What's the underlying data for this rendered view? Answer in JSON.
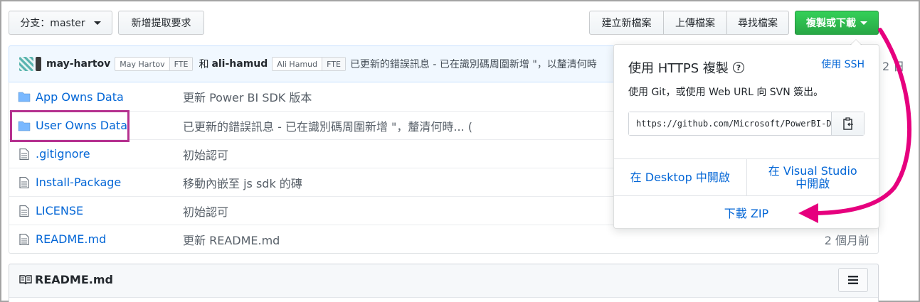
{
  "toolbar": {
    "branch_label": "分支：master",
    "new_pr": "新增提取要求",
    "create_file": "建立新檔案",
    "upload_files": "上傳檔案",
    "find_file": "尋找檔案",
    "clone_download": "複製或下載"
  },
  "commit": {
    "user1": "may-hartov",
    "user1_tag": "May Hartov",
    "user1_badge": "FTE",
    "and": "和",
    "user2": "ali-hamud",
    "user2_tag": "Ali Hamud",
    "user2_badge": "FTE",
    "message": "已更新的錯誤訊息 - 已在識別碼周圍新增 \"，以釐清何時",
    "age_fragment": "2 日"
  },
  "files": [
    {
      "name": "App Owns Data",
      "type": "folder",
      "message": "更新 Power BI SDK 版本",
      "age": ""
    },
    {
      "name": "User Owns Data",
      "type": "folder",
      "message": "已更新的錯誤訊息 - 已在識別碼周圍新增 \"，釐清何時... (",
      "age": ""
    },
    {
      "name": ".gitignore",
      "type": "file",
      "message": "初始認可",
      "age": ""
    },
    {
      "name": "Install-Package",
      "type": "file",
      "message": "移動內嵌至 js sdk 的磚",
      "age": ""
    },
    {
      "name": "LICENSE",
      "type": "file",
      "message": "初始認可",
      "age": ""
    },
    {
      "name": "README.md",
      "type": "file",
      "message": "更新 README.md",
      "age": "2 個月前"
    }
  ],
  "readme": {
    "title": "README.md"
  },
  "clone_popup": {
    "title": "使用 HTTPS 複製",
    "use_ssh": "使用 SSH",
    "description": "使用 Git，或使用 Web URL 向 SVN 簽出。",
    "url": "https://github.com/Microsoft/PowerBI-Developer-Samples.git",
    "open_desktop": "在 Desktop 中開啟",
    "open_vs_line1": "在 Visual Studio",
    "open_vs_line2": "中開啟",
    "download_zip": "下載 ZIP"
  },
  "colors": {
    "link": "#0366d6",
    "green_button": "#28a745",
    "highlight_box": "#b5318f",
    "arrow": "#e6007e"
  }
}
